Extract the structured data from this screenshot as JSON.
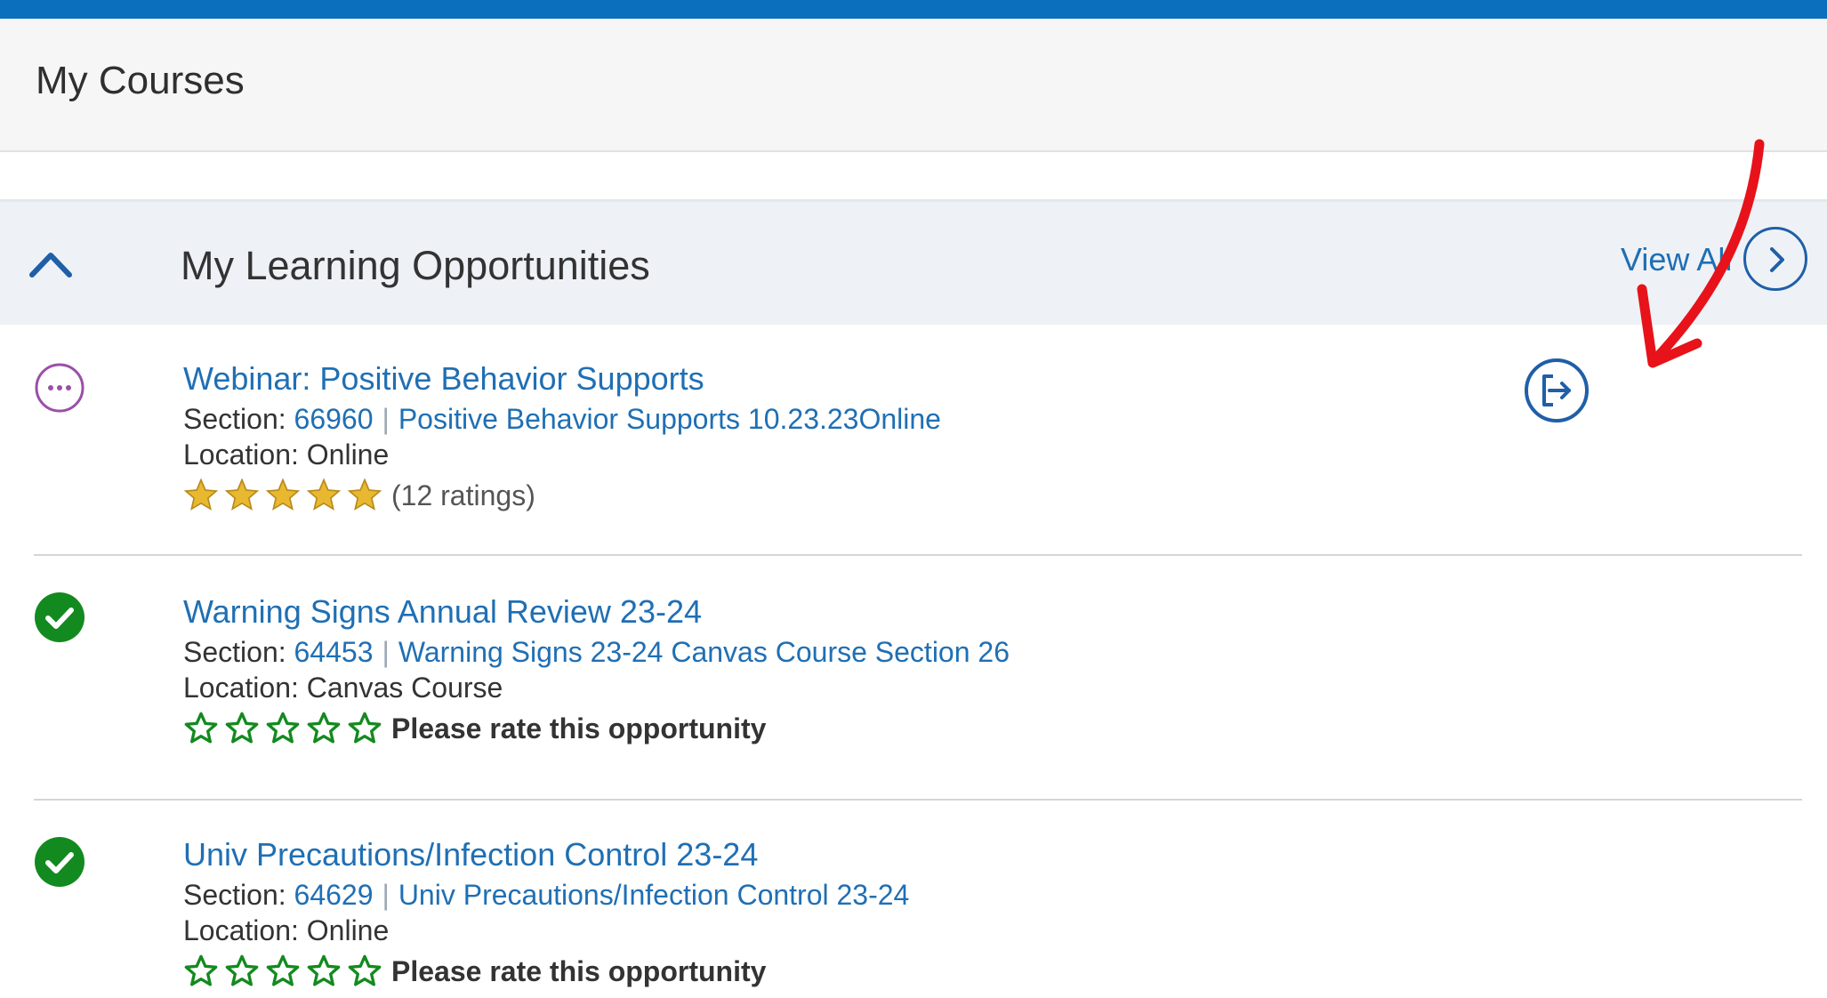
{
  "header": {
    "title": "My Courses"
  },
  "section": {
    "title": "My Learning Opportunities",
    "view_all_label": "View All"
  },
  "items": [
    {
      "title": "Webinar: Positive Behavior Supports",
      "section_label": "Section:",
      "section_number": "66960",
      "section_name": "Positive Behavior Supports 10.23.23Online",
      "location": "Location: Online",
      "status": "in-progress",
      "rating_text": "(12 ratings)",
      "stars_filled": 5
    },
    {
      "title": "Warning Signs Annual Review 23-24",
      "section_label": "Section:",
      "section_number": "64453",
      "section_name": "Warning Signs 23-24 Canvas Course Section 26",
      "location": "Location: Canvas Course",
      "status": "completed",
      "rating_text": "Please rate this opportunity",
      "stars_filled": 0
    },
    {
      "title": "Univ Precautions/Infection Control 23-24",
      "section_label": "Section:",
      "section_number": "64629",
      "section_name": "Univ Precautions/Infection Control 23-24",
      "location": "Location: Online",
      "status": "completed",
      "rating_text": "Please rate this opportunity",
      "stars_filled": 0
    }
  ],
  "colors": {
    "accent_blue": "#1f6fb4",
    "top_bar": "#0b6fbd",
    "completed_green": "#138a1f",
    "in_progress_purple": "#9b4fa8",
    "star_gold": "#e8b830",
    "annotation_red": "#e8121a"
  }
}
